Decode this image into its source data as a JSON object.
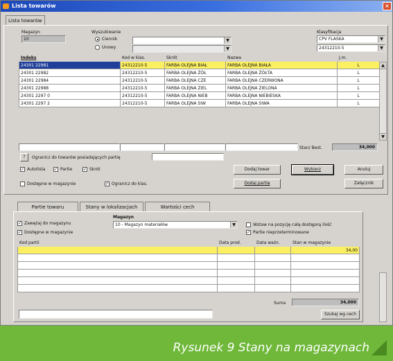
{
  "window": {
    "title": "Lista towarów",
    "close": "×"
  },
  "tabs_top": [
    {
      "label": "Lista towarów"
    }
  ],
  "magazyn": {
    "label": "Magazyn",
    "value": "10"
  },
  "wyszukiwanie": {
    "label": "Wyszukiwanie",
    "options": [
      {
        "label": "Ciennik",
        "selected": true
      },
      {
        "label": "Unowy",
        "selected": false
      }
    ]
  },
  "klasyfikacja": {
    "label": "Klasyfikacja",
    "value1": "CPV FLASKA",
    "value2": "24312210-5"
  },
  "columns": {
    "indeks": "Indeks",
    "kod": "Kod w klas.",
    "skrot": "Skrót",
    "nazwa": "Nazwa",
    "jm": "J.m."
  },
  "products": [
    {
      "indeks": "24301 22981",
      "kod": "24312210-5",
      "skrot": "FARBA OLEJNA BIAŁ",
      "nazwa": "FARBA OLEJNA BIAŁA",
      "jm": "L",
      "selected": true
    },
    {
      "indeks": "24301 22982",
      "kod": "24312210-5",
      "skrot": "FARBA OLEJNA ŻÓŁ",
      "nazwa": "FARBA OLEJNA ŻÓŁTA",
      "jm": "L",
      "selected": false
    },
    {
      "indeks": "24301 22984",
      "kod": "24312210-5",
      "skrot": "FARBA OLEJNA CZE",
      "nazwa": "FARBA OLEJNA CZERWONA",
      "jm": "L",
      "selected": false
    },
    {
      "indeks": "24301 22988",
      "kod": "24312210-5",
      "skrot": "FARBA OLEJNA ZIEL",
      "nazwa": "FARBA OLEJNA ZIELONA",
      "jm": "L",
      "selected": false
    },
    {
      "indeks": "24301 2297 0",
      "kod": "24312210-5",
      "skrot": "FARBA OLEJNA NIEB",
      "nazwa": "FARBA OLEJNA NIEBIESKA",
      "jm": "L",
      "selected": false
    },
    {
      "indeks": "24301 2297 2",
      "kod": "24312210-5",
      "skrot": "FARBA OLEJNA SIW",
      "nazwa": "FARBA OLEJNA SIWA",
      "jm": "L",
      "selected": false
    }
  ],
  "stock": {
    "label": "Stan/ Best.",
    "value": "34,000"
  },
  "ogranicz": {
    "btn": "?",
    "label": "Ogranicz do towarów posiadających partię"
  },
  "checks1": [
    {
      "label": "Autolista",
      "checked": true
    },
    {
      "label": "Partie",
      "checked": true
    },
    {
      "label": "Skrót",
      "checked": true
    }
  ],
  "checks2": [
    {
      "label": "Dostępne w magazynie",
      "checked": false
    },
    {
      "label": "Ogranicz do klas.",
      "checked": true
    }
  ],
  "buttons": {
    "dodaj_towar": "Dodaj towar",
    "wybierz": "Wybierz",
    "anuluj": "Anuluj",
    "dodaj_partie": "Dodaj partię",
    "zalacznik": "Załącznik"
  },
  "tabs_bottom": [
    {
      "label": "Partie towaru"
    },
    {
      "label": "Stany w lokalizacjach"
    },
    {
      "label": "Wartości cech"
    }
  ],
  "bottom": {
    "check_zawezaj": "Zawężaj do magazynu",
    "check_dostepne": "Dostępne w magazynie",
    "magazyn_label": "Magazyn",
    "magazyn_value": "10 - Magazyn materiałów",
    "wstaw": "Wstaw na pozycję całą dostępną ilość",
    "partie_nie": "Partie nieprzeterminowane",
    "cols": {
      "kod_partii": "Kod partii",
      "data_prod": "Data prod.",
      "data_wazn": "Data ważn.",
      "stan": "Stan w magazynie"
    },
    "rows": [
      {
        "kod": "",
        "prod": "",
        "wazn": "",
        "stan": "34,00",
        "selected": true
      },
      {
        "kod": "",
        "prod": "",
        "wazn": "",
        "stan": "",
        "selected": false
      },
      {
        "kod": "",
        "prod": "",
        "wazn": "",
        "stan": "",
        "selected": false
      },
      {
        "kod": "",
        "prod": "",
        "wazn": "",
        "stan": "",
        "selected": false
      },
      {
        "kod": "",
        "prod": "",
        "wazn": "",
        "stan": "",
        "selected": false
      },
      {
        "kod": "",
        "prod": "",
        "wazn": "",
        "stan": "",
        "selected": false
      }
    ],
    "suma_label": "Suma",
    "suma_value": "34,000",
    "szukaj": "Szukaj wg cech"
  },
  "caption": "Rysunek 9 Stany na magazynach",
  "colors": {
    "selection": "#fbef62",
    "footer": "#6fb83a",
    "titlebar": "#1d48b8"
  }
}
